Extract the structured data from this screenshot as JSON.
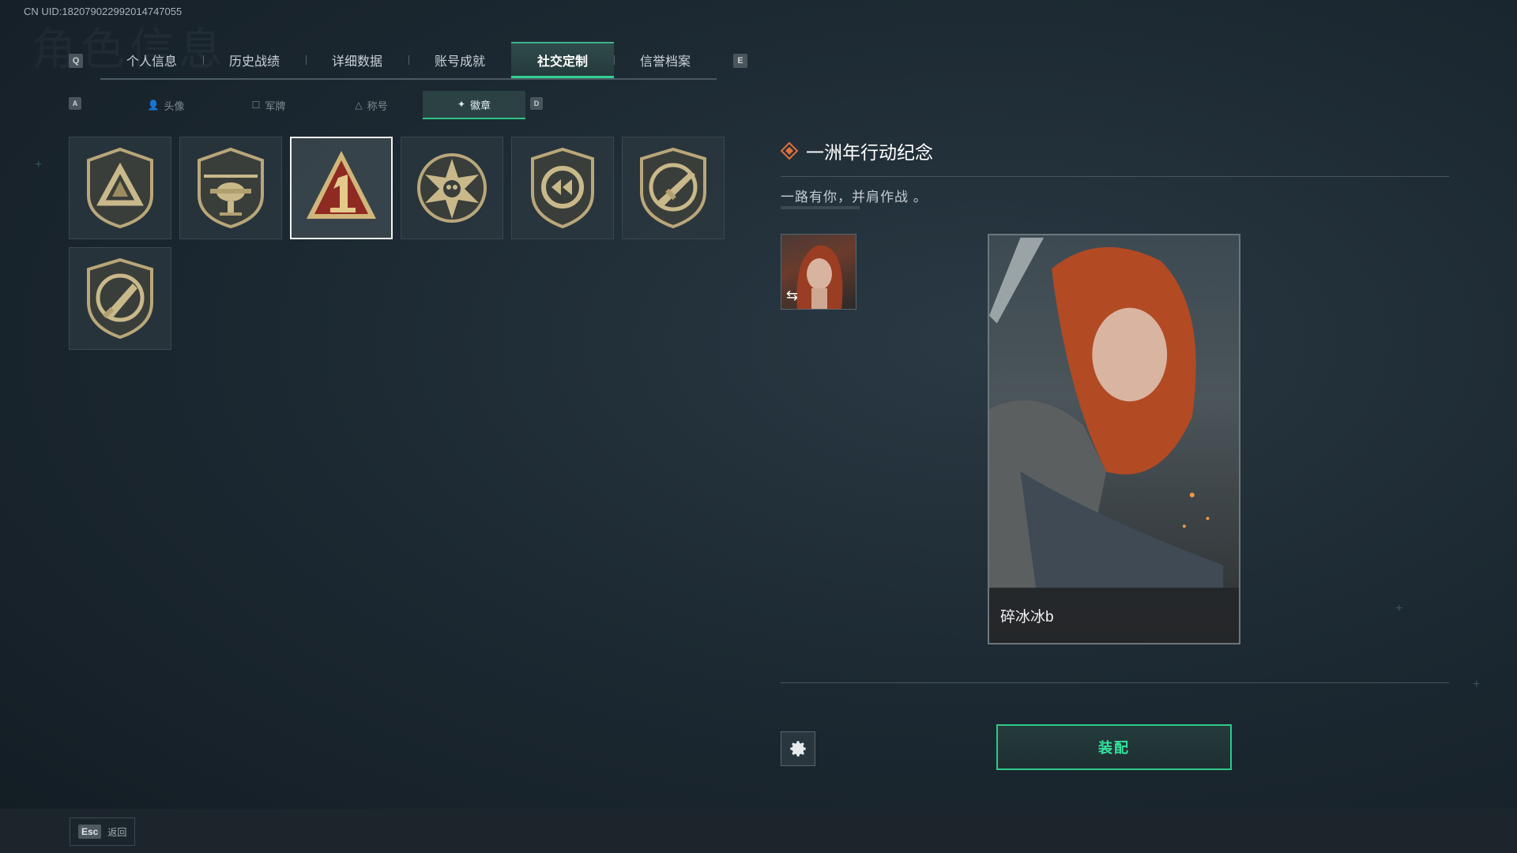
{
  "uid_text": "CN UID:1820790229920147470​55",
  "top_tabs": {
    "left_key": "Q",
    "right_key": "E",
    "items": [
      {
        "label": "个人信息"
      },
      {
        "label": "历史战绩"
      },
      {
        "label": "详细数据"
      },
      {
        "label": "账号成就"
      },
      {
        "label": "社交定制",
        "active": true
      },
      {
        "label": "信誉档案"
      }
    ]
  },
  "sub_tabs": {
    "left_key": "A",
    "right_key": "D",
    "items": [
      {
        "label": "头像",
        "icon": "person-icon"
      },
      {
        "label": "军牌",
        "icon": "dogtag-icon"
      },
      {
        "label": "称号",
        "icon": "title-icon"
      },
      {
        "label": "徽章",
        "icon": "badge-icon",
        "active": true
      }
    ]
  },
  "badges": [
    {
      "name": "triangle-badge-icon"
    },
    {
      "name": "helicopter-badge-icon"
    },
    {
      "name": "one-year-badge-icon",
      "selected": true
    },
    {
      "name": "star-skull-badge-icon"
    },
    {
      "name": "shield-rewind-badge-icon"
    },
    {
      "name": "rifle-badge-icon"
    },
    {
      "name": "knife-badge-icon"
    }
  ],
  "detail": {
    "title": "一洲年行动纪念",
    "description": "一路有你，并肩作战 。",
    "card_name": "碎冰冰b"
  },
  "actions": {
    "equip_label": "装配"
  },
  "bottom": {
    "esc_key": "Esc",
    "esc_label": "返回"
  },
  "colors": {
    "accent_green": "#31d18f",
    "title_diamond": "#e0713a"
  }
}
